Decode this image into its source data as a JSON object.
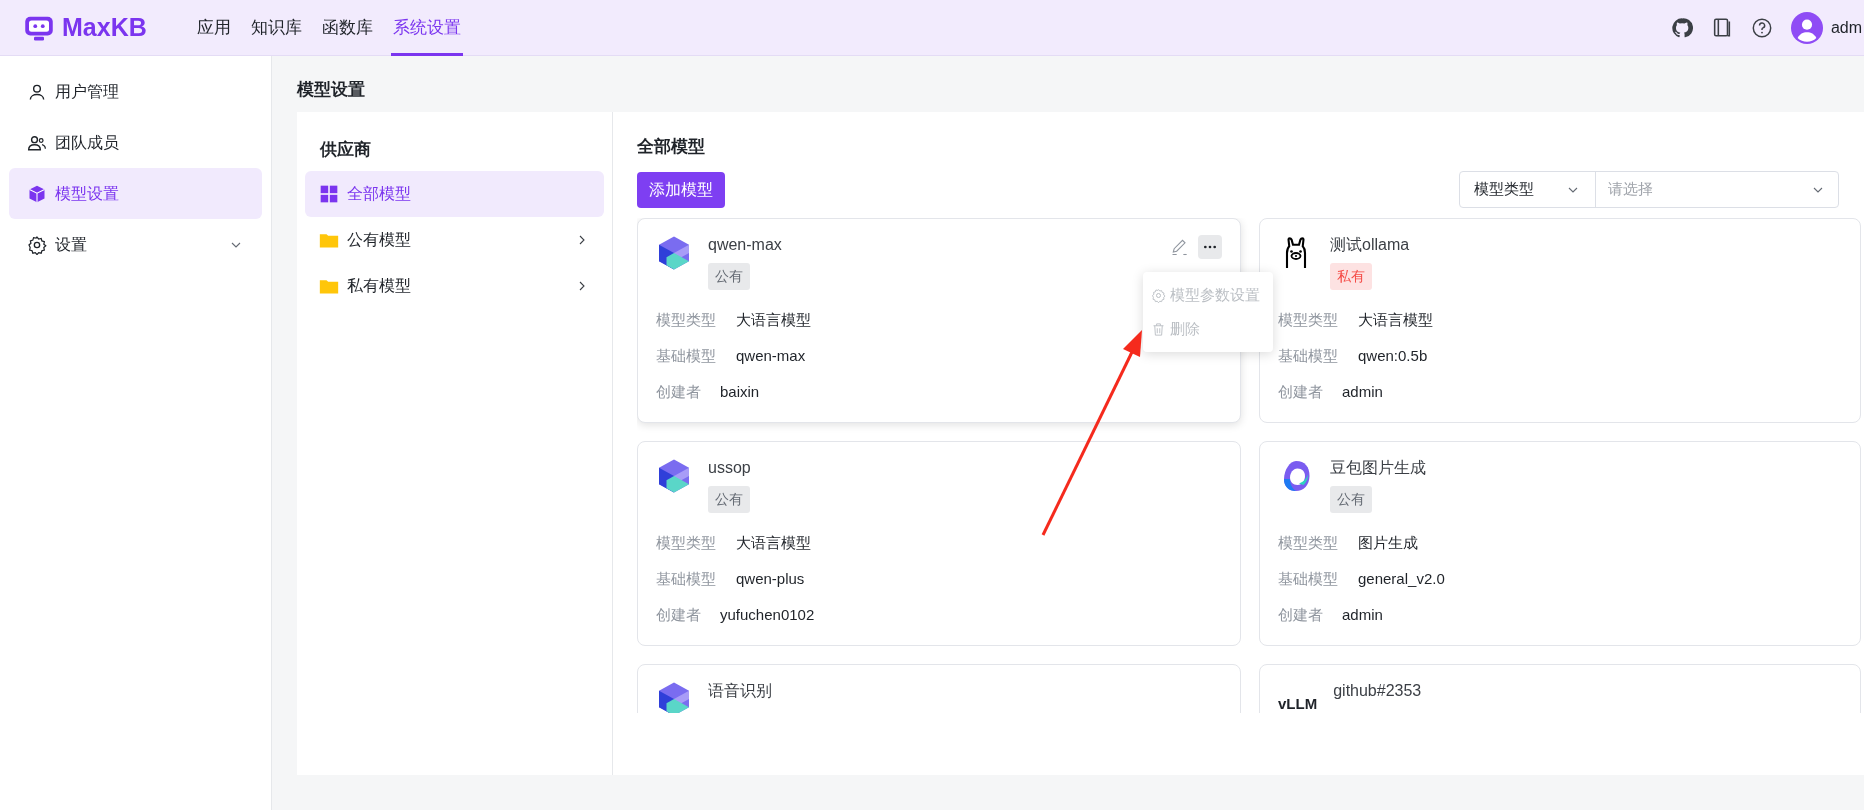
{
  "app": {
    "logo_text": "MaxKB"
  },
  "nav_tabs": [
    {
      "label": "应用",
      "selected": false
    },
    {
      "label": "知识库",
      "selected": false
    },
    {
      "label": "函数库",
      "selected": false
    },
    {
      "label": "系统设置",
      "selected": true
    }
  ],
  "user": {
    "name": "adm"
  },
  "sidebar": {
    "items": [
      {
        "label": "用户管理",
        "kind": "link",
        "selected": false
      },
      {
        "label": "团队成员",
        "kind": "link",
        "selected": false
      },
      {
        "label": "模型设置",
        "kind": "link",
        "selected": true
      },
      {
        "label": "设置",
        "kind": "group",
        "selected": false
      }
    ]
  },
  "page_title": "模型设置",
  "providers": {
    "title": "供应商",
    "items": [
      {
        "label": "全部模型",
        "kind": "all",
        "selected": true
      },
      {
        "label": "公有模型",
        "kind": "folder",
        "selected": false
      },
      {
        "label": "私有模型",
        "kind": "folder",
        "selected": false
      }
    ]
  },
  "models_panel": {
    "title": "全部模型",
    "add_button": "添加模型",
    "filter": {
      "type_label": "模型类型",
      "placeholder": "请选择"
    },
    "cards": [
      {
        "name": "qwen-max",
        "kind": "qwen",
        "hovered": true,
        "tag": {
          "label": "公有",
          "kind": "public"
        },
        "fields": [
          {
            "label": "模型类型",
            "value": "大语言模型"
          },
          {
            "label": "基础模型",
            "value": "qwen-max"
          },
          {
            "label": "创建者",
            "value": "baixin"
          }
        ],
        "menu": {
          "items": [
            {
              "label": "模型参数设置",
              "disabled": true
            },
            {
              "label": "删除",
              "disabled": true
            }
          ]
        }
      },
      {
        "name": "测试ollama",
        "kind": "llama",
        "hovered": false,
        "tag": {
          "label": "私有",
          "kind": "private"
        },
        "fields": [
          {
            "label": "模型类型",
            "value": "大语言模型"
          },
          {
            "label": "基础模型",
            "value": "qwen:0.5b"
          },
          {
            "label": "创建者",
            "value": "admin"
          }
        ]
      },
      {
        "name": "ussop",
        "kind": "qwen",
        "hovered": false,
        "tag": {
          "label": "公有",
          "kind": "public"
        },
        "fields": [
          {
            "label": "模型类型",
            "value": "大语言模型"
          },
          {
            "label": "基础模型",
            "value": "qwen-plus"
          },
          {
            "label": "创建者",
            "value": "yufuchen0102"
          }
        ]
      },
      {
        "name": "豆包图片生成",
        "kind": "doubao",
        "hovered": false,
        "tag": {
          "label": "公有",
          "kind": "public"
        },
        "fields": [
          {
            "label": "模型类型",
            "value": "图片生成"
          },
          {
            "label": "基础模型",
            "value": "general_v2.0"
          },
          {
            "label": "创建者",
            "value": "admin"
          }
        ]
      },
      {
        "name": "语音识别",
        "kind": "qwen",
        "hovered": false
      },
      {
        "name": "github#2353",
        "kind": "vllm",
        "logo_text": "vLLM",
        "hovered": false
      }
    ]
  }
}
